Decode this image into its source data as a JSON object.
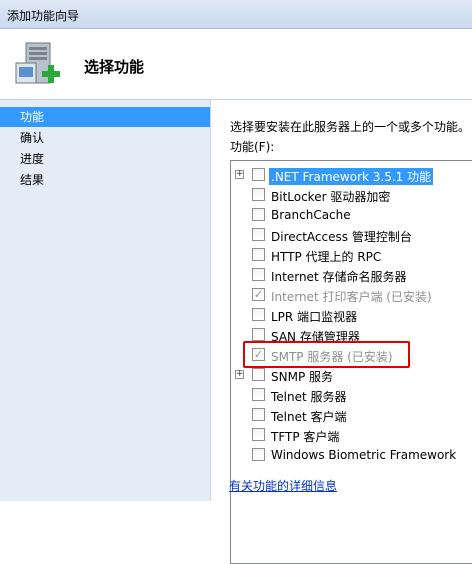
{
  "window": {
    "title": "添加功能向导"
  },
  "header": {
    "title": "选择功能",
    "icon": "server-add-icon"
  },
  "nav": {
    "items": [
      {
        "label": "功能",
        "active": true
      },
      {
        "label": "确认",
        "active": false
      },
      {
        "label": "进度",
        "active": false
      },
      {
        "label": "结果",
        "active": false
      }
    ]
  },
  "main": {
    "instruction": "选择要安装在此服务器上的一个或多个功能。",
    "features_label": "功能(F):",
    "features": [
      {
        "label": ".NET Framework 3.5.1 功能",
        "expandable": true,
        "checked": false,
        "selected": true,
        "disabled": false
      },
      {
        "label": "BitLocker 驱动器加密",
        "expandable": false,
        "checked": false,
        "selected": false,
        "disabled": false
      },
      {
        "label": "BranchCache",
        "expandable": false,
        "checked": false,
        "selected": false,
        "disabled": false
      },
      {
        "label": "DirectAccess 管理控制台",
        "expandable": false,
        "checked": false,
        "selected": false,
        "disabled": false
      },
      {
        "label": "HTTP 代理上的 RPC",
        "expandable": false,
        "checked": false,
        "selected": false,
        "disabled": false
      },
      {
        "label": "Internet 存储命名服务器",
        "expandable": false,
        "checked": false,
        "selected": false,
        "disabled": false
      },
      {
        "label": "Internet 打印客户端  (已安装)",
        "expandable": false,
        "checked": true,
        "selected": false,
        "disabled": true
      },
      {
        "label": "LPR 端口监视器",
        "expandable": false,
        "checked": false,
        "selected": false,
        "disabled": false
      },
      {
        "label": "SAN 存储管理器",
        "expandable": false,
        "checked": false,
        "selected": false,
        "disabled": false
      },
      {
        "label": "SMTP 服务器  (已安装)",
        "expandable": false,
        "checked": true,
        "selected": false,
        "disabled": true
      },
      {
        "label": "SNMP 服务",
        "expandable": true,
        "checked": false,
        "selected": false,
        "disabled": false
      },
      {
        "label": "Telnet 服务器",
        "expandable": false,
        "checked": false,
        "selected": false,
        "disabled": false
      },
      {
        "label": "Telnet 客户端",
        "expandable": false,
        "checked": false,
        "selected": false,
        "disabled": false
      },
      {
        "label": "TFTP 客户端",
        "expandable": false,
        "checked": false,
        "selected": false,
        "disabled": false
      },
      {
        "label": "Windows Biometric Framework",
        "expandable": false,
        "checked": false,
        "selected": false,
        "disabled": false
      }
    ],
    "more_info_link": "有关功能的详细信息",
    "highlight_color": "#e00000",
    "selection_color": "#3399ff"
  }
}
